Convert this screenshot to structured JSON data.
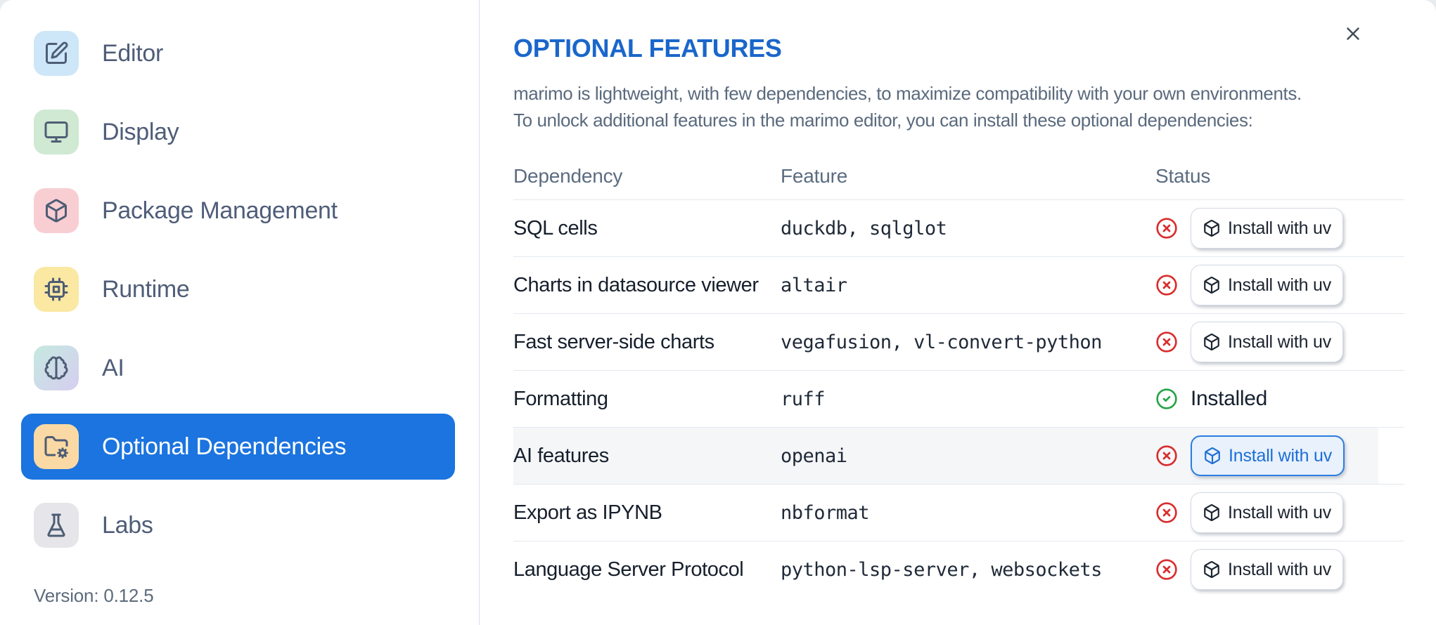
{
  "sidebar": {
    "items": [
      {
        "label": "Editor",
        "icon": "edit-icon",
        "tile_bg": "#cde6f8",
        "selected": false
      },
      {
        "label": "Display",
        "icon": "monitor-icon",
        "tile_bg": "#cfe9d2",
        "selected": false
      },
      {
        "label": "Package Management",
        "icon": "package-icon",
        "tile_bg": "#f8ced3",
        "selected": false
      },
      {
        "label": "Runtime",
        "icon": "cpu-icon",
        "tile_bg": "#fae8a3",
        "selected": false
      },
      {
        "label": "AI",
        "icon": "brain-icon",
        "tile_bg": "linear-gradient(135deg,#c5e9e0 0%,#d6cef0 100%)",
        "selected": false
      },
      {
        "label": "Optional Dependencies",
        "icon": "folder-gear-icon",
        "tile_bg": "#fbd9a4",
        "selected": true
      },
      {
        "label": "Labs",
        "icon": "flask-icon",
        "tile_bg": "#e6e6ea",
        "selected": false
      }
    ],
    "version_label": "Version: 0.12.5"
  },
  "dialog": {
    "title": "OPTIONAL FEATURES",
    "description_line1": "marimo is lightweight, with few dependencies, to maximize compatibility with your own environments.",
    "description_line2": "To unlock additional features in the marimo editor, you can install these optional dependencies:",
    "close_icon": "close-icon"
  },
  "table": {
    "headers": [
      "Dependency",
      "Feature",
      "Status"
    ],
    "install_button_label": "Install with uv",
    "install_button_icon": "package-icon",
    "installed_label": "Installed",
    "status_icons": {
      "installed": "circle-check-icon",
      "not_installed": "circle-x-icon"
    },
    "rows": [
      {
        "dependency": "SQL cells",
        "feature": "duckdb, sqlglot",
        "installed": false,
        "highlighted": false
      },
      {
        "dependency": "Charts in datasource viewer",
        "feature": "altair",
        "installed": false,
        "highlighted": false
      },
      {
        "dependency": "Fast server-side charts",
        "feature": "vegafusion, vl-convert-python",
        "installed": false,
        "highlighted": false
      },
      {
        "dependency": "Formatting",
        "feature": "ruff",
        "installed": true,
        "highlighted": false
      },
      {
        "dependency": "AI features",
        "feature": "openai",
        "installed": false,
        "highlighted": true
      },
      {
        "dependency": "Export as IPYNB",
        "feature": "nbformat",
        "installed": false,
        "highlighted": false
      },
      {
        "dependency": "Language Server Protocol",
        "feature": "python-lsp-server, websockets",
        "installed": false,
        "highlighted": false
      }
    ]
  },
  "colors": {
    "accent_blue": "#1b74df",
    "title_blue": "#1a66cb",
    "error_red": "#d92d2d",
    "success_green": "#27a348",
    "highlight_button_bg": "#e9f1fc",
    "highlight_button_border": "#2c7de0",
    "highlight_button_text": "#1c6fd6"
  }
}
